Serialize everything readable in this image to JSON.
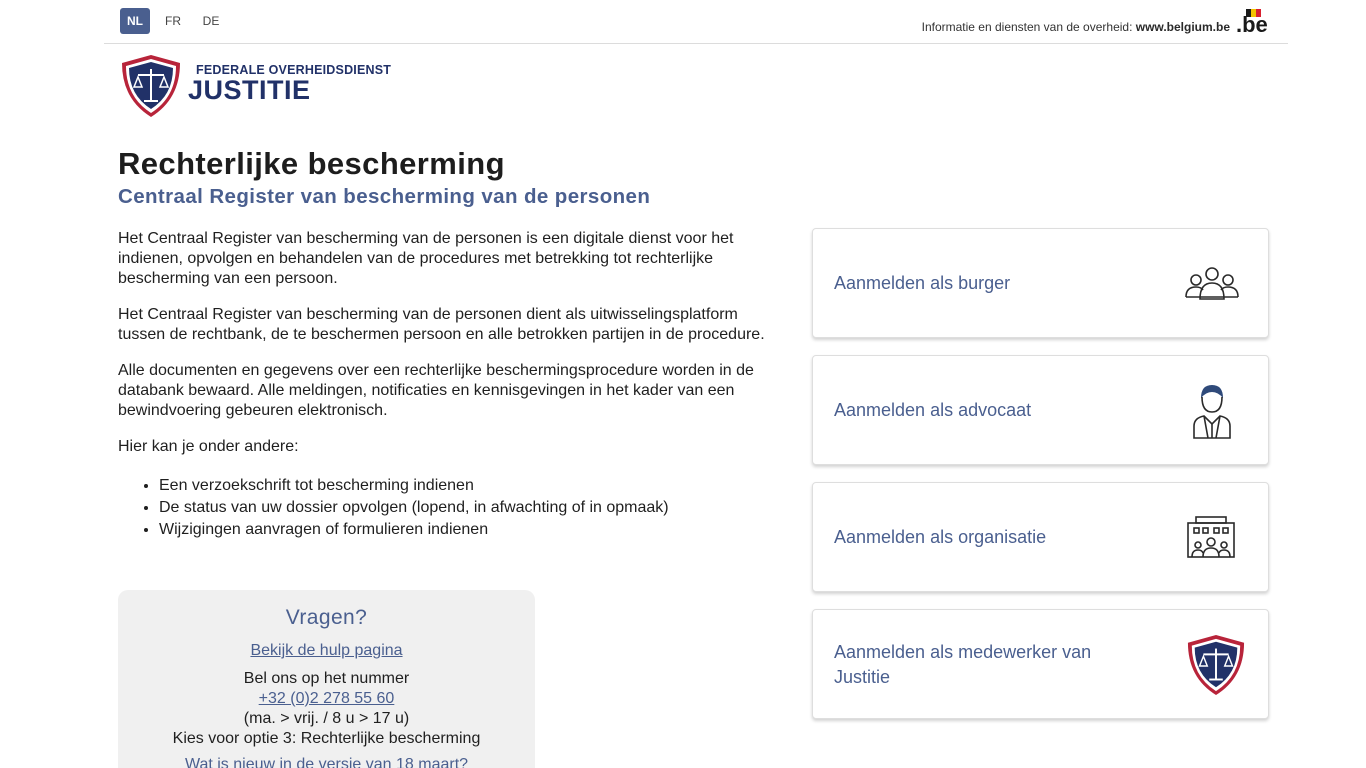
{
  "languages": [
    {
      "code": "NL",
      "active": true
    },
    {
      "code": "FR",
      "active": false
    },
    {
      "code": "DE",
      "active": false
    }
  ],
  "header": {
    "belgium_text": "Informatie en diensten van de overheid:",
    "belgium_link": "www.belgium.be",
    "be_logo": ".be",
    "logo_line1": "FEDERALE OVERHEIDSDIENST",
    "logo_line2": "JUSTITIE"
  },
  "page": {
    "title": "Rechterlijke bescherming",
    "subtitle": "Centraal Register van bescherming van de personen",
    "paragraphs": [
      "Het Centraal Register van bescherming van de personen is een digitale dienst voor het indienen, opvolgen en behandelen van de procedures met betrekking tot rechterlijke bescherming van een persoon.",
      "Het Centraal Register van bescherming van de personen dient als uitwisselingsplatform tussen de rechtbank, de te beschermen persoon en alle betrokken partijen in de procedure.",
      "Alle documenten en gegevens over een rechterlijke beschermingsprocedure worden in de databank bewaard. Alle meldingen, notificaties en kennisgevingen in het kader van een bewindvoering gebeuren elektronisch.",
      "Hier kan je onder andere:"
    ],
    "list": [
      "Een verzoekschrift tot bescherming indienen",
      "De status van uw dossier opvolgen (lopend, in afwachting of in opmaak)",
      "Wijzigingen aanvragen of formulieren indienen"
    ]
  },
  "help": {
    "title": "Vragen?",
    "help_link": "Bekijk de hulp pagina",
    "call_text": "Bel ons op het nummer",
    "phone": "+32 (0)2 278 55 60",
    "hours": "(ma. > vrij. / 8 u > 17 u)",
    "option": "Kies voor optie 3: Rechterlijke bescherming",
    "news_link": "Wat is nieuw in de versie van 18 maart?"
  },
  "cards": [
    {
      "label": "Aanmelden als burger",
      "icon": "citizens-icon"
    },
    {
      "label": "Aanmelden als advocaat",
      "icon": "lawyer-icon"
    },
    {
      "label": "Aanmelden als organisatie",
      "icon": "organisation-icon"
    },
    {
      "label": "Aanmelden als medewerker van Justitie",
      "icon": "justice-shield-icon"
    }
  ],
  "colors": {
    "accent": "#4a5f8f",
    "brand_navy": "#213168",
    "shield_red": "#b8243a",
    "help_bg": "#f0f0f0"
  }
}
